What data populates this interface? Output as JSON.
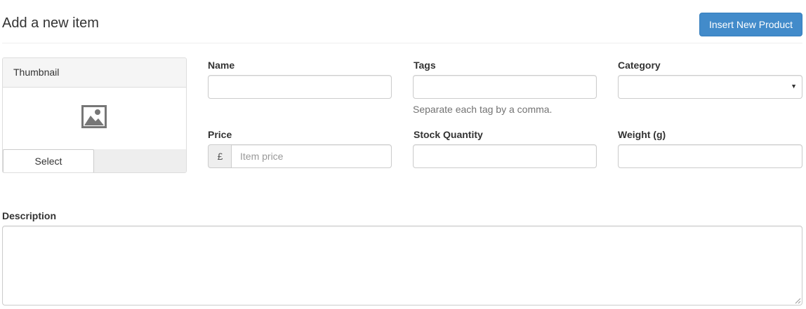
{
  "header": {
    "title": "Add a new item",
    "insert_button_label": "Insert New Product"
  },
  "thumbnail": {
    "heading": "Thumbnail",
    "icon": "image-icon",
    "select_label": "Select"
  },
  "fields": {
    "name": {
      "label": "Name",
      "value": ""
    },
    "tags": {
      "label": "Tags",
      "value": "",
      "help": "Separate each tag by a comma."
    },
    "category": {
      "label": "Category",
      "selected": ""
    },
    "price": {
      "label": "Price",
      "currency": "£",
      "placeholder": "Item price",
      "value": ""
    },
    "stock": {
      "label": "Stock Quantity",
      "value": ""
    },
    "weight": {
      "label": "Weight (g)",
      "value": ""
    },
    "description": {
      "label": "Description",
      "value": ""
    }
  },
  "colors": {
    "primary_button": "#428bca",
    "border": "#cccccc",
    "panel_heading_bg": "#f5f5f5"
  }
}
